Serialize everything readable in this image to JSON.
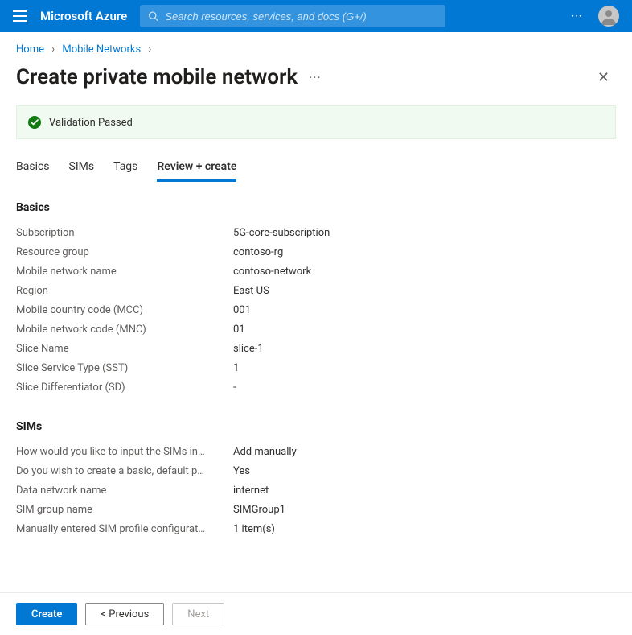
{
  "topbar": {
    "brand": "Microsoft Azure",
    "search_placeholder": "Search resources, services, and docs (G+/)"
  },
  "breadcrumbs": {
    "home": "Home",
    "section": "Mobile Networks"
  },
  "page": {
    "title": "Create private mobile network",
    "more": "···"
  },
  "banner": {
    "text": "Validation Passed"
  },
  "tabs": {
    "basics": "Basics",
    "sims": "SIMs",
    "tags": "Tags",
    "review": "Review + create"
  },
  "sections": {
    "basics": {
      "title": "Basics",
      "items": [
        {
          "k": "Subscription",
          "v": "5G-core-subscription"
        },
        {
          "k": "Resource group",
          "v": "contoso-rg"
        },
        {
          "k": "Mobile network name",
          "v": "contoso-network"
        },
        {
          "k": "Region",
          "v": "East US"
        },
        {
          "k": "Mobile country code (MCC)",
          "v": "001"
        },
        {
          "k": "Mobile network code (MNC)",
          "v": "01"
        },
        {
          "k": "Slice Name",
          "v": "slice-1"
        },
        {
          "k": "Slice Service Type (SST)",
          "v": "1"
        },
        {
          "k": "Slice Differentiator (SD)",
          "v": "-"
        }
      ]
    },
    "sims": {
      "title": "SIMs",
      "items": [
        {
          "k": "How would you like to input the SIMs in…",
          "v": "Add manually"
        },
        {
          "k": "Do you wish to create a basic, default p…",
          "v": "Yes"
        },
        {
          "k": "Data network name",
          "v": "internet"
        },
        {
          "k": "SIM group name",
          "v": "SIMGroup1"
        },
        {
          "k": "Manually entered SIM profile configurat…",
          "v": "1 item(s)"
        }
      ]
    }
  },
  "footer": {
    "create": "Create",
    "previous": "< Previous",
    "next": "Next"
  }
}
